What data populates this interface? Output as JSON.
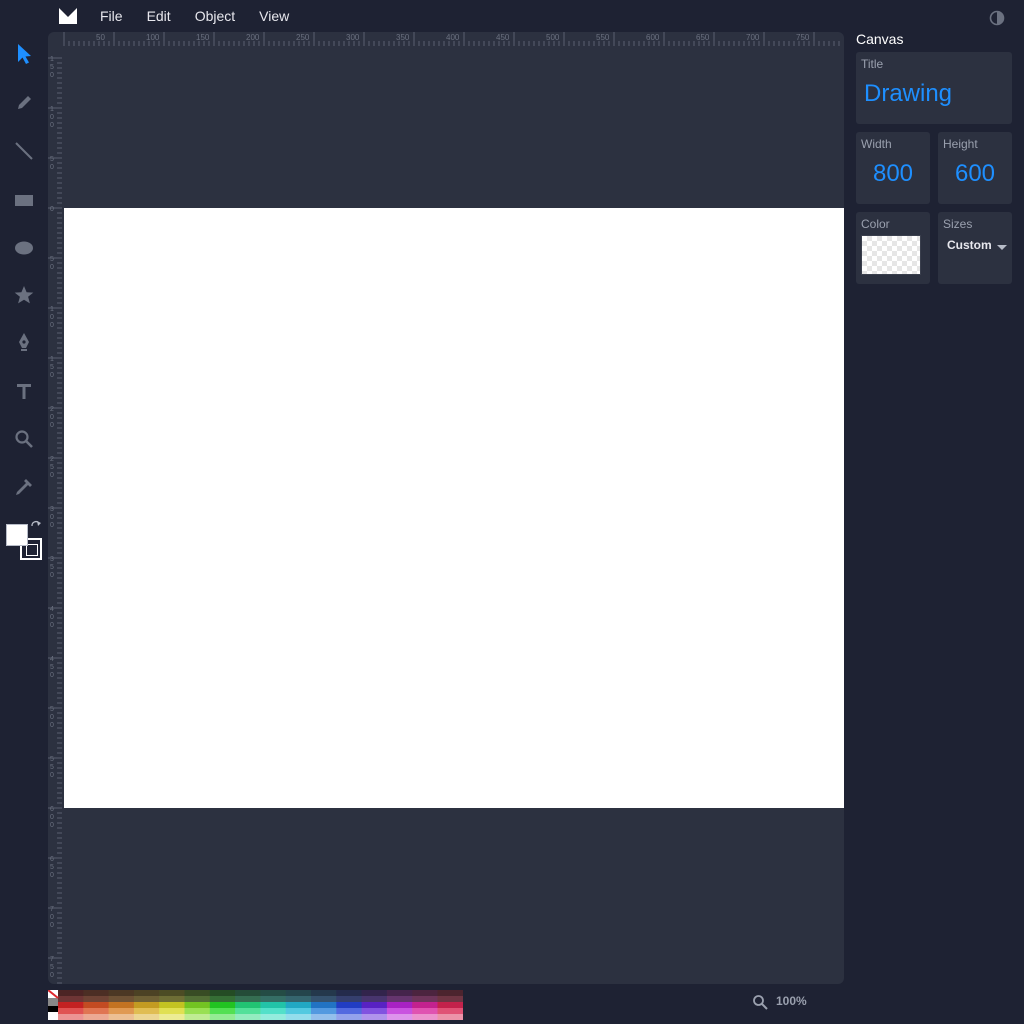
{
  "menu": {
    "items": [
      "File",
      "Edit",
      "Object",
      "View"
    ]
  },
  "tools": [
    "select-tool",
    "pencil-tool",
    "line-tool",
    "rectangle-tool",
    "ellipse-tool",
    "star-tool",
    "pen-tool",
    "text-tool",
    "zoom-tool",
    "eyedropper-tool"
  ],
  "colors": {
    "accent": "#1e8fff",
    "fill": "#ffffff",
    "stroke": "#000000",
    "page_bg": "#ffffff"
  },
  "ruler": {
    "top_ticks": [
      "50",
      "100",
      "150",
      "200",
      "250",
      "300",
      "350",
      "400",
      "450",
      "500",
      "550",
      "600",
      "650",
      "700",
      "750"
    ],
    "left_ticks": [
      "150",
      "100",
      "50",
      "0",
      "50",
      "100",
      "150",
      "200",
      "250",
      "300",
      "350",
      "400",
      "450",
      "500",
      "550",
      "600",
      "650",
      "700",
      "750"
    ]
  },
  "panel": {
    "heading": "Canvas",
    "title": {
      "label": "Title",
      "value": "Drawing"
    },
    "width": {
      "label": "Width",
      "value": "800"
    },
    "height": {
      "label": "Height",
      "value": "600"
    },
    "color": {
      "label": "Color"
    },
    "sizes": {
      "label": "Sizes",
      "value": "Custom"
    }
  },
  "status": {
    "zoom": "100%"
  }
}
